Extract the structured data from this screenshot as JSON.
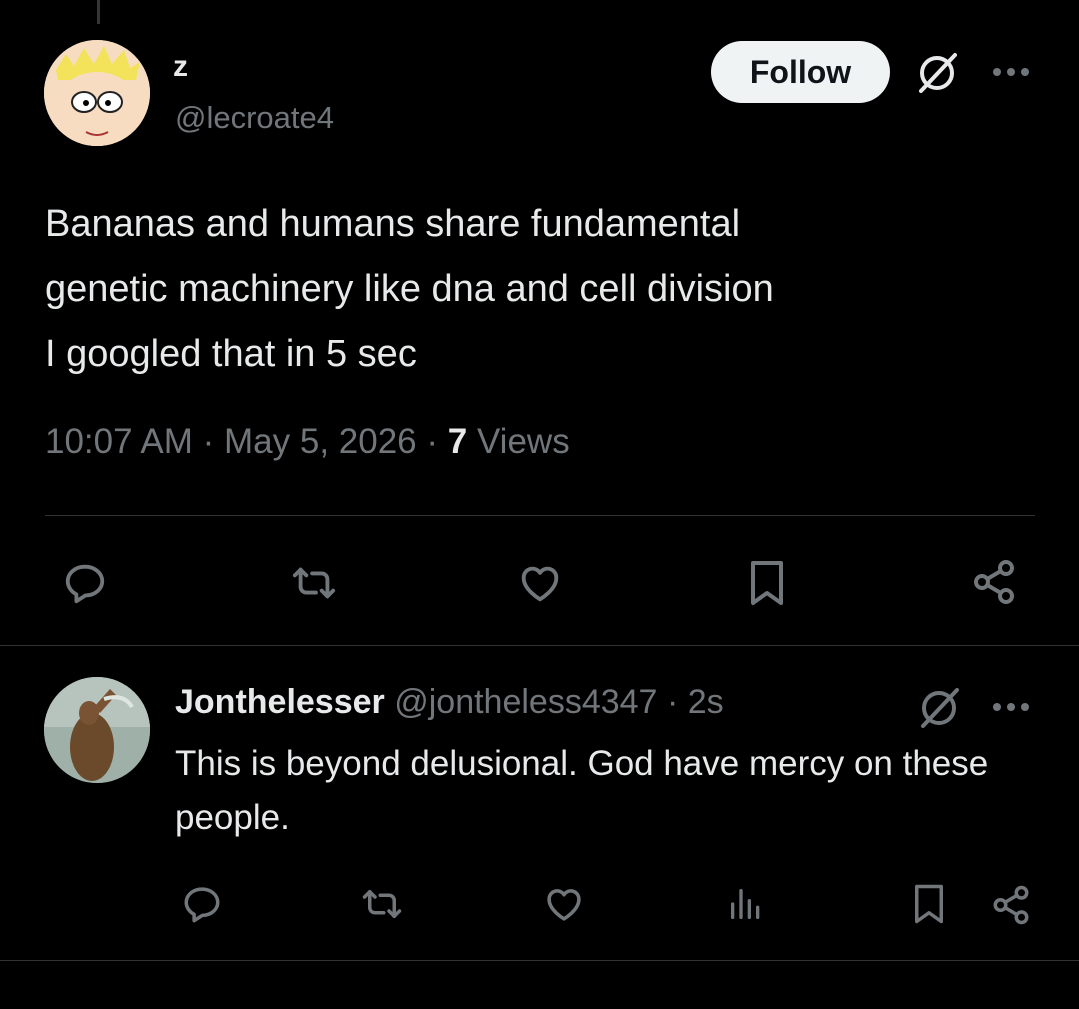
{
  "post": {
    "author_name": "z",
    "author_handle": "@lecroate4",
    "follow_label": "Follow",
    "text": "Bananas and humans share fundamental\ngenetic machinery like dna and cell division\nI googled that in 5 sec",
    "time": "10:07 AM",
    "date": "May 5, 2026",
    "separator": "·",
    "views_count": "7",
    "views_label": "Views"
  },
  "reply": {
    "author_name": "Jonthelesser",
    "author_handle": "@jontheless4347",
    "separator": "·",
    "time": "2s",
    "text": "This is beyond delusional. God have mercy on these people."
  },
  "icons": {
    "grok": "grok-icon",
    "more": "more-icon",
    "reply": "reply-icon",
    "repost": "repost-icon",
    "like": "like-icon",
    "bookmark": "bookmark-icon",
    "share": "share-icon",
    "views": "views-icon"
  },
  "colors": {
    "background": "#000000",
    "text_primary": "#e7e9ea",
    "text_secondary": "#71767b",
    "divider": "#2f3336",
    "follow_bg": "#eff3f4"
  }
}
